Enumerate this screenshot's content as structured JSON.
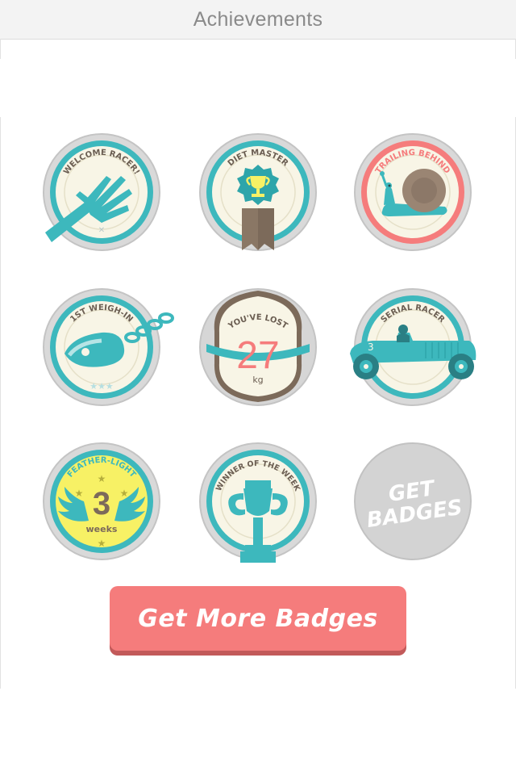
{
  "header": {
    "title": "Achievements"
  },
  "colors": {
    "teal": "#3db8bd",
    "cream": "#f8f5e6",
    "ring_gray": "#c9c9c9",
    "coral": "#f57c7c",
    "brown": "#7c6a5a",
    "yellow": "#f7f165",
    "disabled_gray": "#d3d3d3"
  },
  "badges": [
    {
      "id": "welcome",
      "title": "WELCOME RACER!",
      "icon": "hand-icon"
    },
    {
      "id": "diet-master",
      "title": "DIET MASTER",
      "icon": "trophy-rosette-icon"
    },
    {
      "id": "trailing",
      "title": "TRAILING BEHIND",
      "icon": "snail-icon"
    },
    {
      "id": "weigh-in",
      "title": "1ST WEIGH-IN",
      "icon": "ball-and-chain-icon"
    },
    {
      "id": "lost",
      "title": "YOU'VE LOST",
      "value": "27",
      "unit": "kg",
      "icon": "scale-icon"
    },
    {
      "id": "serial-racer",
      "title": "SERIAL RACER",
      "number": "3",
      "icon": "race-car-icon"
    },
    {
      "id": "feather-light",
      "title": "FEATHER-LIGHT",
      "value": "3",
      "unit": "weeks",
      "icon": "wings-icon"
    },
    {
      "id": "winner",
      "title": "WINNER OF THE WEEK",
      "icon": "trophy-icon"
    },
    {
      "id": "get-badges",
      "line1": "GET",
      "line2": "BADGES"
    }
  ],
  "cta": {
    "label": "Get More Badges"
  }
}
